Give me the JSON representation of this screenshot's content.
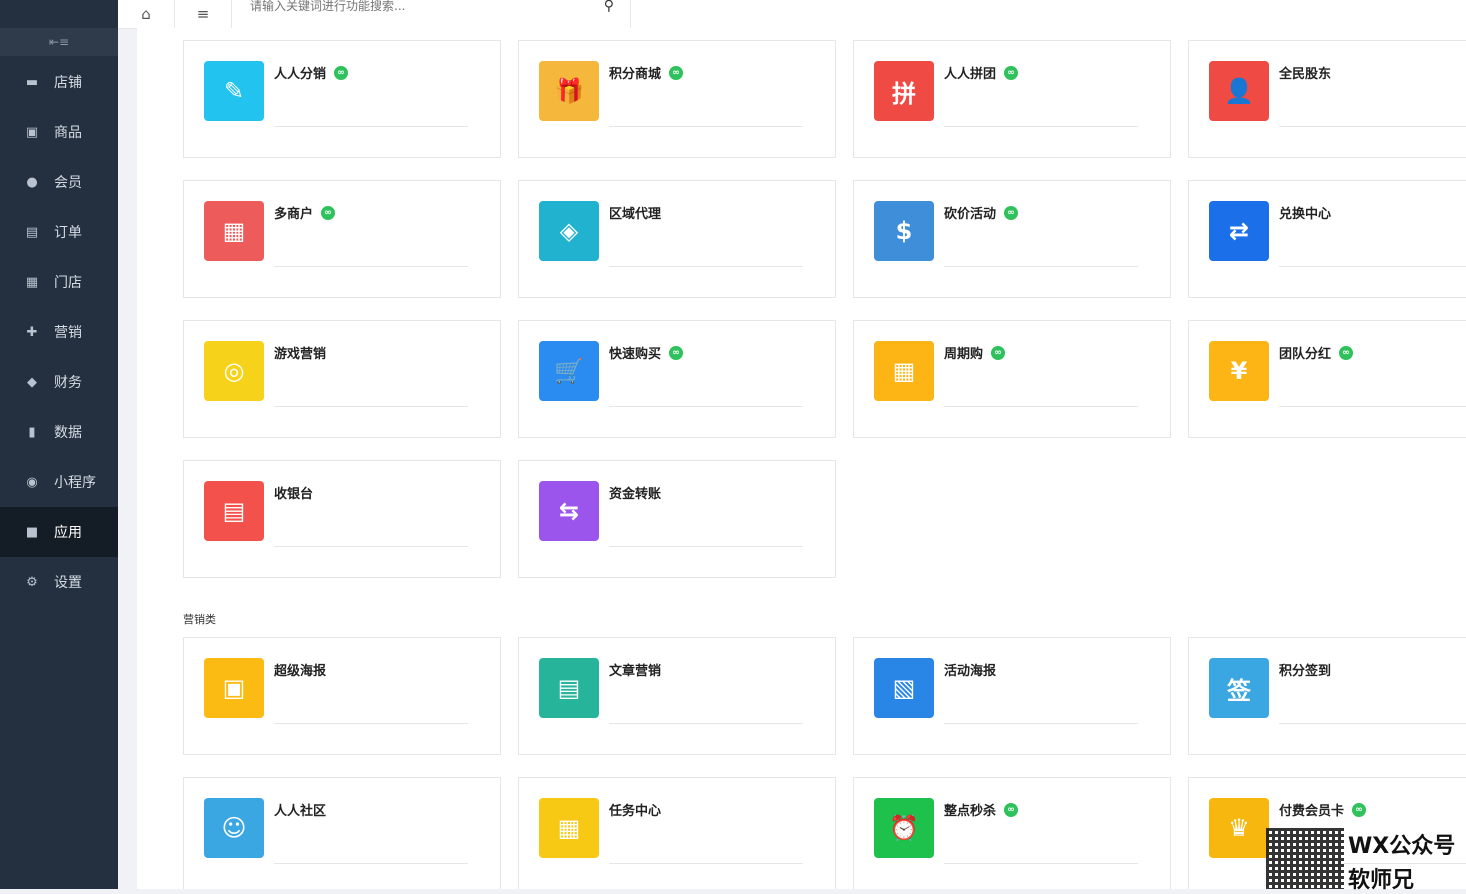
{
  "sidebar": {
    "collapse_icon": "menu-fold-icon",
    "items": [
      {
        "label": "店铺",
        "icon": "shop-icon",
        "glyph": "▬"
      },
      {
        "label": "商品",
        "icon": "goods-icon",
        "glyph": "▣"
      },
      {
        "label": "会员",
        "icon": "user-icon",
        "glyph": "●"
      },
      {
        "label": "订单",
        "icon": "order-icon",
        "glyph": "▤"
      },
      {
        "label": "门店",
        "icon": "store-icon",
        "glyph": "▦"
      },
      {
        "label": "营销",
        "icon": "gift-icon",
        "glyph": "✚"
      },
      {
        "label": "财务",
        "icon": "money-bag-icon",
        "glyph": "◆"
      },
      {
        "label": "数据",
        "icon": "bar-chart-icon",
        "glyph": "▮"
      },
      {
        "label": "小程序",
        "icon": "mini-program-icon",
        "glyph": "◉"
      },
      {
        "label": "应用",
        "icon": "apps-icon",
        "glyph": "■",
        "active": true
      },
      {
        "label": "设置",
        "icon": "gear-icon",
        "glyph": "⚙"
      }
    ]
  },
  "topbar": {
    "home_icon": "home-icon",
    "menu_icon": "hamburger-icon",
    "search_placeholder": "请输入关键词进行功能搜索...",
    "search_icon": "search-icon"
  },
  "apps": [
    {
      "title": "人人分销",
      "linked": true,
      "color": "#22c3ee",
      "glyph": "✎"
    },
    {
      "title": "积分商城",
      "linked": true,
      "color": "#f5b83d",
      "glyph": "🎁"
    },
    {
      "title": "人人拼团",
      "linked": true,
      "color": "#f04a45",
      "glyph": "拼"
    },
    {
      "title": "全民股东",
      "linked": false,
      "color": "#f04a45",
      "glyph": "👤"
    },
    {
      "title": "多商户",
      "linked": true,
      "color": "#ee5b5b",
      "glyph": "▦"
    },
    {
      "title": "区域代理",
      "linked": false,
      "color": "#20b2cf",
      "glyph": "◈"
    },
    {
      "title": "砍价活动",
      "linked": true,
      "color": "#3e8ed9",
      "glyph": "$"
    },
    {
      "title": "兑换中心",
      "linked": false,
      "color": "#1b6fe8",
      "glyph": "⇄"
    },
    {
      "title": "游戏营销",
      "linked": false,
      "color": "#f7d21a",
      "glyph": "◎"
    },
    {
      "title": "快速购买",
      "linked": true,
      "color": "#2a8cf0",
      "glyph": "🛒"
    },
    {
      "title": "周期购",
      "linked": true,
      "color": "#fdb515",
      "glyph": "▦"
    },
    {
      "title": "团队分红",
      "linked": true,
      "color": "#fdb515",
      "glyph": "¥"
    },
    {
      "title": "收银台",
      "linked": false,
      "color": "#f2524b",
      "glyph": "▤"
    },
    {
      "title": "资金转账",
      "linked": false,
      "color": "#9b55ec",
      "glyph": "⇆"
    }
  ],
  "section_label": "营销类",
  "marketing_apps": [
    {
      "title": "超级海报",
      "linked": false,
      "color": "#fbbb12",
      "glyph": "▣"
    },
    {
      "title": "文章营销",
      "linked": false,
      "color": "#26b59b",
      "glyph": "▤"
    },
    {
      "title": "活动海报",
      "linked": false,
      "color": "#2a86e6",
      "glyph": "▧"
    },
    {
      "title": "积分签到",
      "linked": false,
      "color": "#3aa6e2",
      "glyph": "签"
    },
    {
      "title": "人人社区",
      "linked": false,
      "color": "#3aa6e2",
      "glyph": "☺"
    },
    {
      "title": "任务中心",
      "linked": false,
      "color": "#f7c915",
      "glyph": "▦"
    },
    {
      "title": "整点秒杀",
      "linked": true,
      "color": "#1ec14b",
      "glyph": "⏰"
    },
    {
      "title": "付费会员卡",
      "linked": true,
      "color": "#f8b70f",
      "glyph": "♛"
    }
  ],
  "watermark": {
    "line1": "WX公众号",
    "line2": "软师兄"
  }
}
